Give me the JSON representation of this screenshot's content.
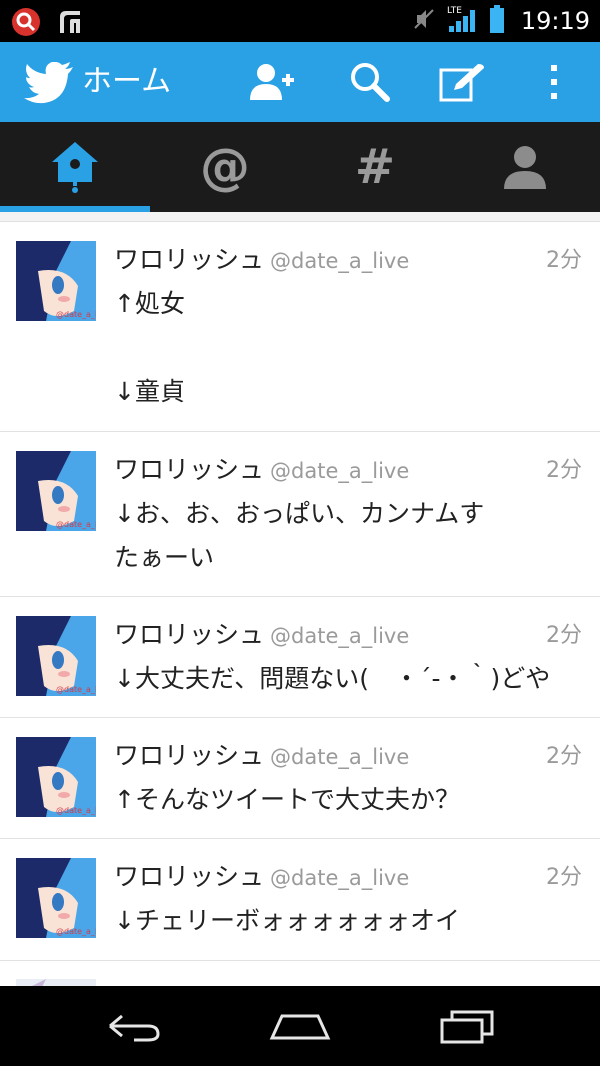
{
  "status_bar": {
    "time": "19:19",
    "network": "LTE"
  },
  "action_bar": {
    "title": "ホーム",
    "icons": [
      "twitter-bird-icon",
      "add-user-icon",
      "search-icon",
      "compose-icon",
      "overflow-menu-icon"
    ],
    "color": "#2aa0e5"
  },
  "tabs": [
    {
      "name": "home",
      "icon": "home-icon",
      "selected": true
    },
    {
      "name": "mentions",
      "label": "@",
      "selected": false
    },
    {
      "name": "discover",
      "label": "#",
      "selected": false
    },
    {
      "name": "me",
      "icon": "profile-icon",
      "selected": false
    }
  ],
  "tweets": [
    {
      "name": "ワロリッシュ",
      "handle": "@date_a_live",
      "time": "2分",
      "text": "↑処女\n\n↓童貞"
    },
    {
      "name": "ワロリッシュ",
      "handle": "@date_a_live",
      "time": "2分",
      "text": "↓お、お、おっぱい、カンナムす\nたぁーい"
    },
    {
      "name": "ワロリッシュ",
      "handle": "@date_a_live",
      "time": "2分",
      "text": "↓大丈夫だ、問題ない(　・´-・｀)どや"
    },
    {
      "name": "ワロリッシュ",
      "handle": "@date_a_live",
      "time": "2分",
      "text": "↑そんなツイートで大丈夫か？"
    },
    {
      "name": "ワロリッシュ",
      "handle": "@date_a_live",
      "time": "2分",
      "text": "↓チェリーボォォォォォォオイ"
    }
  ]
}
